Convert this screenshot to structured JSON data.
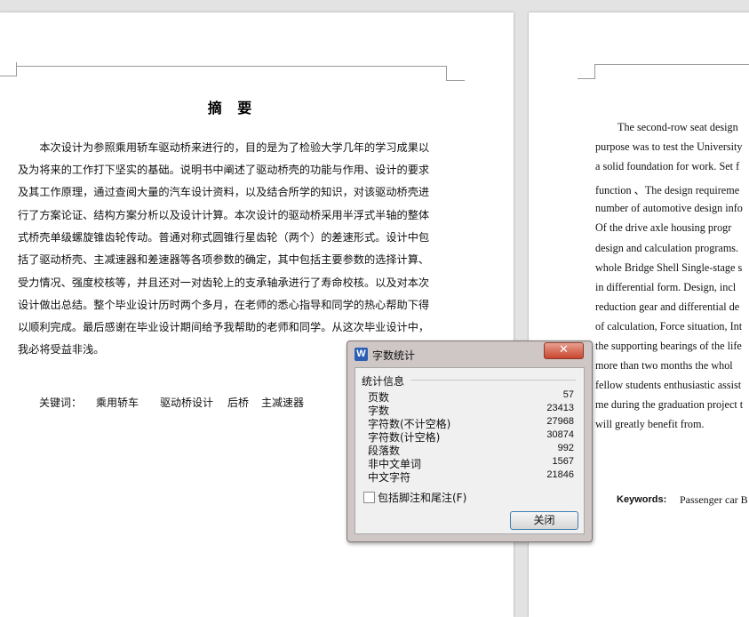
{
  "left_page": {
    "title": "摘 要",
    "lines": [
      "　　本次设计为参照乘用轿车驱动桥来进行的，目的是为了检验大学几年的学习成果以",
      "及为将来的工作打下坚实的基础。说明书中阐述了驱动桥壳的功能与作用、设计的要求",
      "及其工作原理，通过查阅大量的汽车设计资料，以及结合所学的知识，对该驱动桥壳进",
      "行了方案论证、结构方案分析以及设计计算。本次设计的驱动桥采用半浮式半轴的整体",
      "式桥壳单级螺旋锥齿轮传动。普通对称式圆锥行星齿轮（两个）的差速形式。设计中包",
      "括了驱动桥壳、主减速器和差速器等各项参数的确定，其中包括主要参数的选择计算、",
      "受力情况、强度校核等，并且还对一对齿轮上的支承轴承进行了寿命校核。以及对本次",
      "设计做出总结。整个毕业设计历时两个多月，在老师的悉心指导和同学的热心帮助下得",
      "以顺利完成。最后感谢在毕业设计期间给予我帮助的老师和同学。从这次毕业设计中，",
      "我必将受益非浅。"
    ],
    "keywords_label": "关键词：",
    "keywords": [
      "乘用轿车",
      "驱动桥设计",
      "后桥",
      "主减速器"
    ]
  },
  "right_page": {
    "lines": [
      "The second-row seat design",
      "purpose was to test the University",
      "a solid foundation for work. Set f",
      "function 、The design requireme",
      "number of automotive design info",
      "Of the drive axle housing progr",
      "design and calculation programs.",
      "whole Bridge Shell Single-stage s",
      "in differential form. Design, incl",
      "reduction gear and differential de",
      "of calculation, Force situation, Int",
      "the supporting bearings of the life",
      "more than two months the whol",
      "fellow students enthusiastic assist",
      "me during the graduation project t",
      "will greatly benefit from."
    ],
    "keywords_label": "Keywords:",
    "keywords_text": "Passenger car B"
  },
  "dialog": {
    "icon": "W",
    "title": "字数统计",
    "close_glyph": "✕",
    "group_title": "统计信息",
    "stats": [
      {
        "label": "页数",
        "value": "57"
      },
      {
        "label": "字数",
        "value": "23413"
      },
      {
        "label": "字符数(不计空格)",
        "value": "27968"
      },
      {
        "label": "字符数(计空格)",
        "value": "30874"
      },
      {
        "label": "段落数",
        "value": "992"
      },
      {
        "label": "非中文单词",
        "value": "1567"
      },
      {
        "label": "中文字符",
        "value": "21846"
      }
    ],
    "checkbox_label": "包括脚注和尾注(F)",
    "checkbox_checked": false,
    "close_button": "关闭"
  }
}
